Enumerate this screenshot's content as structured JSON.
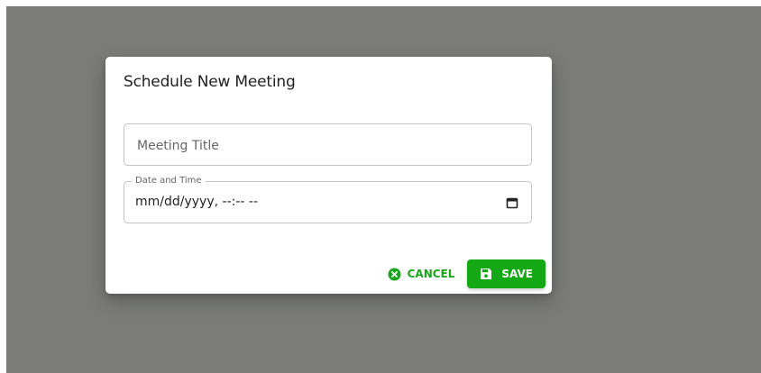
{
  "dialog": {
    "title": "Schedule New Meeting",
    "title_field": {
      "placeholder": "Meeting Title",
      "value": ""
    },
    "datetime_field": {
      "label": "Date and Time",
      "value": "mm/dd/yyyy, --:-- --",
      "icon": "calendar-icon"
    },
    "actions": {
      "cancel_label": "CANCEL",
      "cancel_icon": "close-circle-icon",
      "save_label": "SAVE",
      "save_icon": "floppy-disk-icon"
    }
  },
  "colors": {
    "backdrop": "#7b7c79",
    "accent": "#15a815"
  }
}
